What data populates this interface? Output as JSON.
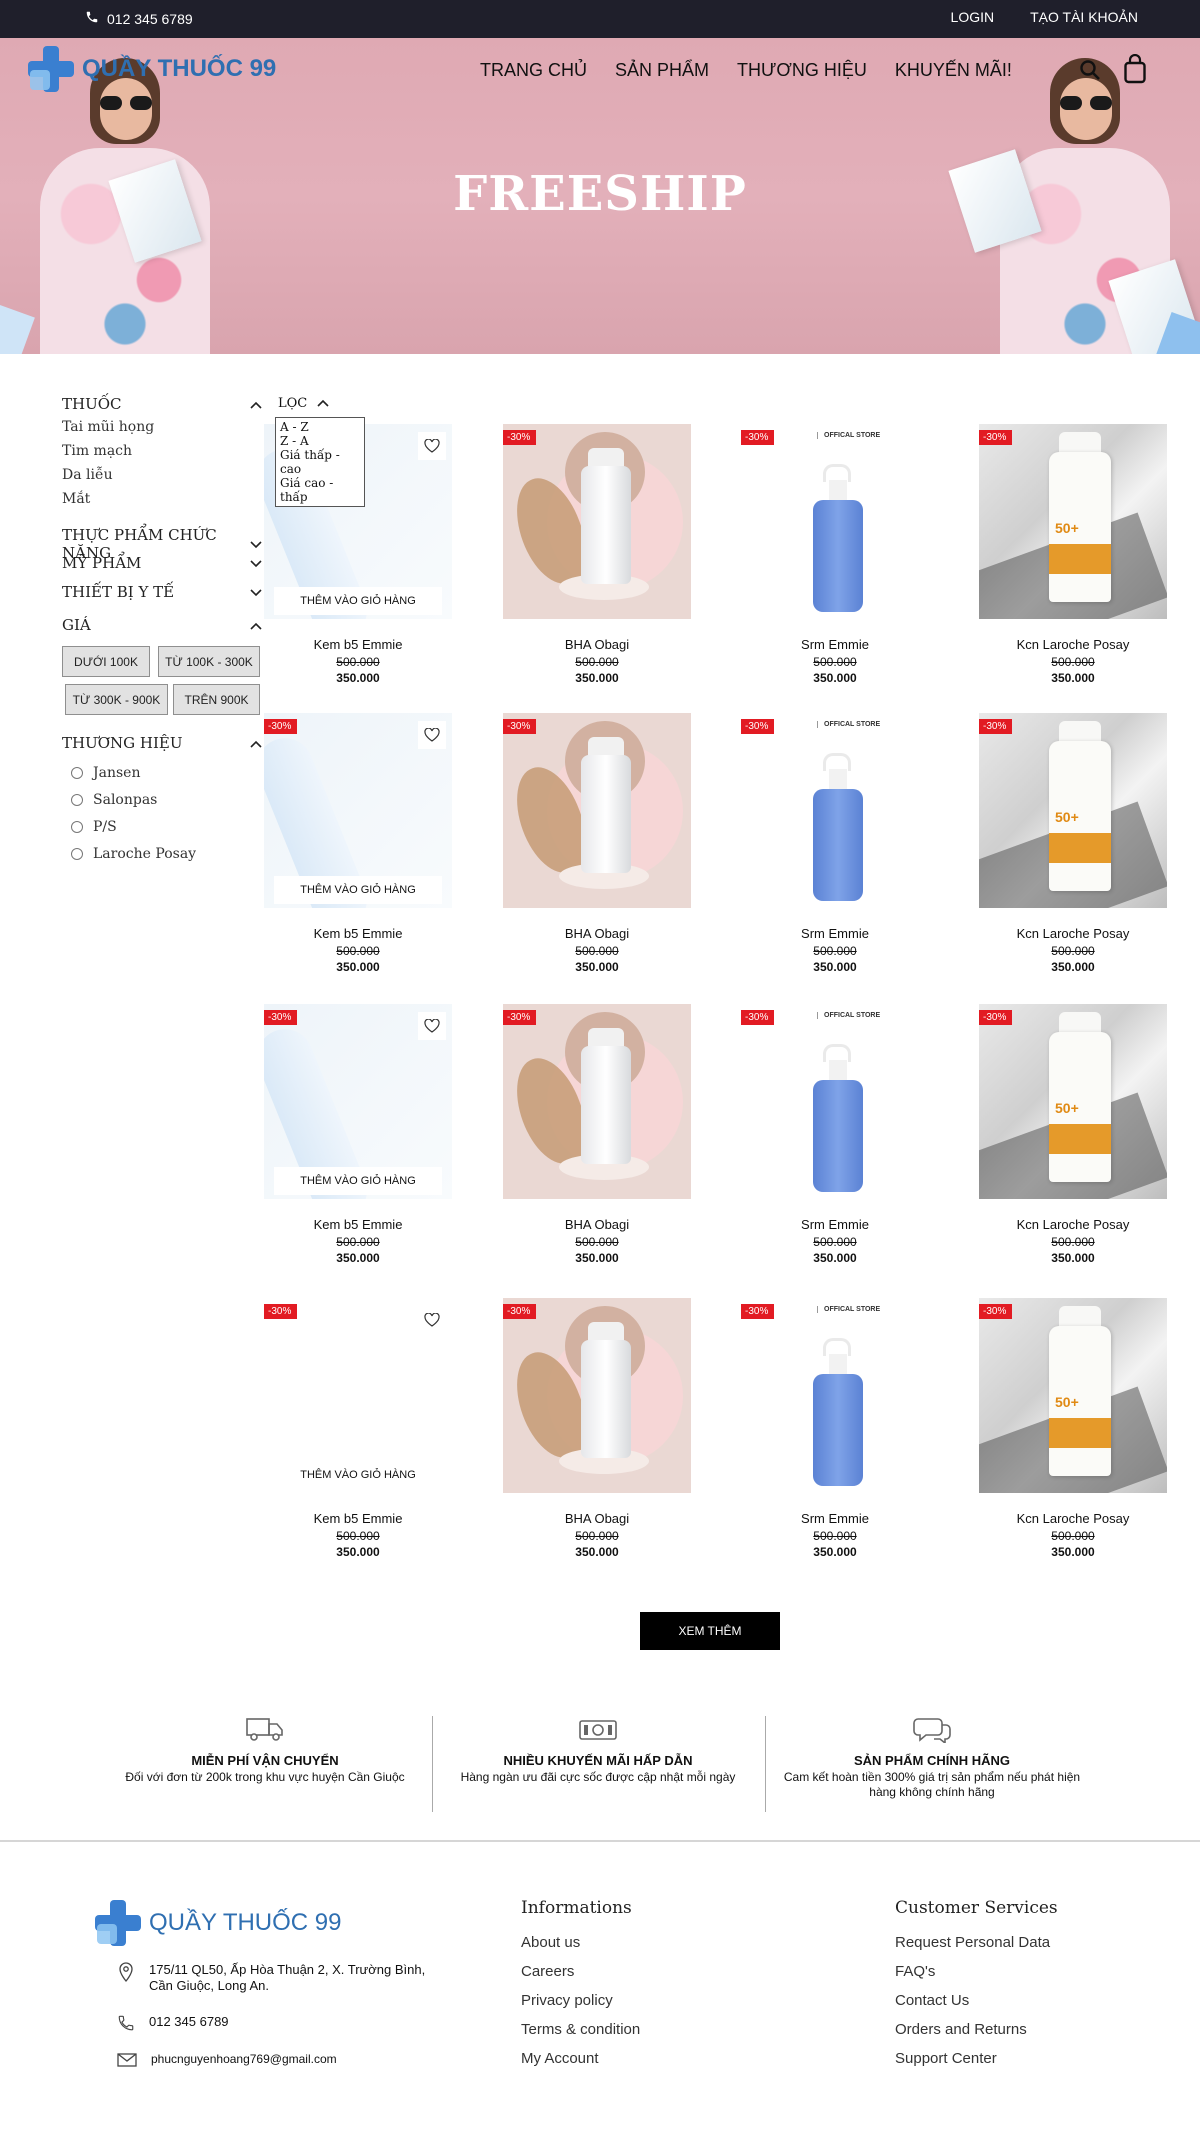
{
  "topbar": {
    "phone": "012 345 6789",
    "login": "LOGIN",
    "register": "TẠO TÀI KHOẢN"
  },
  "brand": {
    "name": "QUẦY THUỐC 99"
  },
  "nav": [
    "TRANG CHỦ",
    "SẢN PHẨM",
    "THƯƠNG HIỆU",
    "KHUYẾN MÃI!"
  ],
  "hero": {
    "title": "FREESHIP"
  },
  "sidebar": {
    "thuoc": {
      "label": "THUỐC",
      "items": [
        "Tai mũi họng",
        "Tim mạch",
        "Da liễu",
        "Mắt"
      ]
    },
    "tpcn": "THỰC PHẨM CHỨC NĂNG",
    "mypham": "MỸ PHẨM",
    "thietbi": "THIẾT BỊ Y TẾ",
    "gia": {
      "label": "GIÁ",
      "buttons": [
        "DƯỚI 100K",
        "TỪ 100K - 300K",
        "TỪ 300K - 900K",
        "TRÊN 900K"
      ]
    },
    "thuonghieu": {
      "label": "THƯƠNG HIỆU",
      "items": [
        "Jansen",
        "Salonpas",
        "P/S",
        "Laroche Posay"
      ]
    }
  },
  "sort": {
    "label": "LỌC",
    "options": [
      "A - Z",
      "Z - A",
      "Giá thấp - cao",
      "Giá cao - thấp"
    ]
  },
  "product_common": {
    "badge": "-30%",
    "add_to_cart": "THÊM VÀO GIỎ HÀNG",
    "old_price": "500.000",
    "new_price": "350.000",
    "store_label": "OFFICAL STORE"
  },
  "products": [
    "Kem b5 Emmie",
    "BHA Obagi",
    "Srm Emmie",
    "Kcn Laroche Posay"
  ],
  "more_button": "XEM THÊM",
  "features": [
    {
      "title": "MIỄN PHÍ VẬN CHUYỂN",
      "desc": "Đối với đơn từ 200k trong khu vực huyện Cần Giuộc",
      "icon": "truck-icon"
    },
    {
      "title": "NHIỀU KHUYẾN MÃI HẤP DẪN",
      "desc": "Hàng ngàn ưu đãi cực sốc được cập nhật mỗi ngày",
      "icon": "money-icon"
    },
    {
      "title": "SẢN PHẨM CHÍNH HÃNG",
      "desc": "Cam kết hoàn tiền 300% giá trị sản phẩm nếu phát hiện hàng không chính hãng",
      "icon": "chat-icon"
    }
  ],
  "footer": {
    "address": "175/11 QL50, Ấp Hòa Thuận 2, X. Trường Bình, Cần Giuộc, Long An.",
    "phone": "012 345 6789",
    "email": "phucnguyenhoang769@gmail.com",
    "informations": {
      "title": "Informations",
      "links": [
        "About us",
        "Careers",
        "Privacy policy",
        "Terms & condition",
        "My Account"
      ]
    },
    "customer": {
      "title": "Customer Services",
      "links": [
        "Request Personal Data",
        "FAQ's",
        "Contact Us",
        "Orders and Returns",
        "Support Center"
      ]
    }
  },
  "colors": {
    "topbar": "#1f1f2b",
    "brand_blue": "#2f6fb1",
    "badge_red": "#e21b23",
    "hero_pink": "#dfa9b3"
  }
}
